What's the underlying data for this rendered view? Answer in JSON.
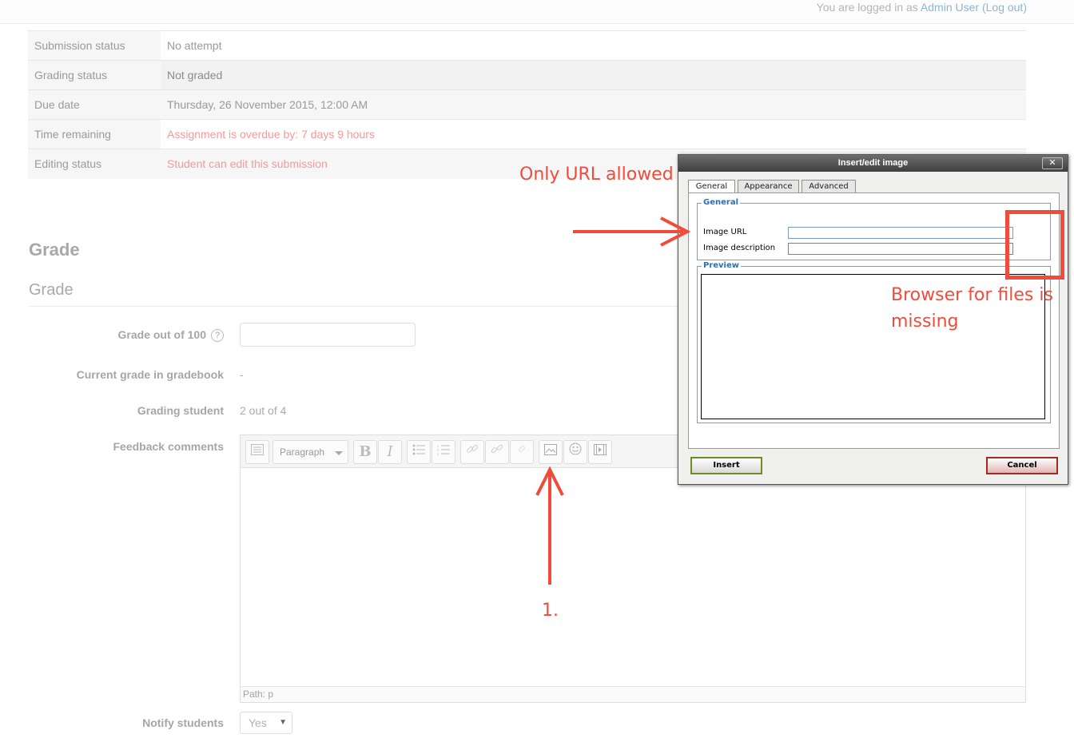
{
  "header": {
    "logged_in_prefix": "You are logged in as ",
    "user_name": "Admin User",
    "logout_label": "(Log out)"
  },
  "status": {
    "rows": [
      {
        "key": "Submission status",
        "value": "No attempt"
      },
      {
        "key": "Grading status",
        "value": "Not graded"
      },
      {
        "key": "Due date",
        "value": "Thursday, 26 November 2015, 12:00 AM"
      },
      {
        "key": "Time remaining",
        "value": "Assignment is overdue by: 7 days 9 hours"
      },
      {
        "key": "Editing status",
        "value": "Student can edit this submission"
      }
    ]
  },
  "grade": {
    "heading": "Grade",
    "subheading": "Grade",
    "grade_out_of_label": "Grade out of 100",
    "grade_value": "",
    "current_grade_label": "Current grade in gradebook",
    "current_grade_value": "-",
    "grading_student_label": "Grading student",
    "grading_student_value": "2 out of 4",
    "feedback_label": "Feedback comments",
    "notify_label": "Notify students",
    "notify_value": "Yes"
  },
  "editor": {
    "paragraph_label": "Paragraph",
    "bold_label": "B",
    "italic_label": "I",
    "path_label": "Path: p",
    "icons": [
      "toggle-toolbar-icon",
      "bold-icon",
      "italic-icon",
      "bullet-list-icon",
      "numbered-list-icon",
      "link-icon",
      "unlink-icon",
      "anchor-icon",
      "image-icon",
      "emoticon-icon",
      "media-icon"
    ]
  },
  "dialog": {
    "title": "Insert/edit image",
    "close_label": "✕",
    "tabs": [
      "General",
      "Appearance",
      "Advanced"
    ],
    "general_legend": "General",
    "image_url_label": "Image URL",
    "image_description_label": "Image description",
    "preview_legend": "Preview",
    "insert_label": "Insert",
    "cancel_label": "Cancel"
  },
  "annotations": {
    "url_note": "Only URL allowed",
    "browser_note_line1": "Browser for files is",
    "browser_note_line2": "missing",
    "step_label": "1.",
    "color": "#f04c3c"
  }
}
